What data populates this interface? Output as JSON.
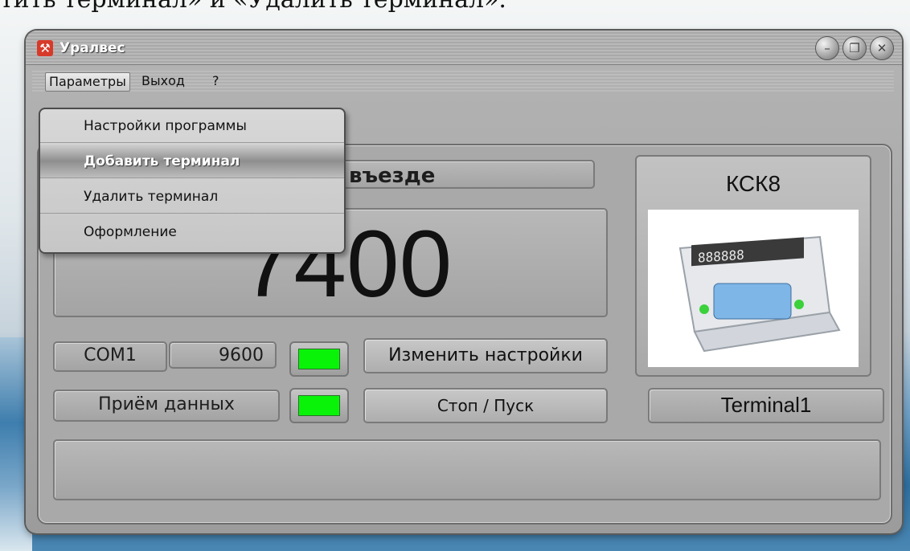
{
  "page_caption": "тить терминал» и «Удалить терминал».",
  "window": {
    "title": "Уралвес",
    "app_icon": "hammer-pick-icon",
    "controls": [
      "minimize-icon",
      "restore-icon",
      "close-icon"
    ]
  },
  "menu": {
    "items": [
      {
        "label": "Параметры",
        "active": true
      },
      {
        "label": "Выход"
      },
      {
        "label": "?"
      }
    ],
    "dropdown": [
      "Настройки программы",
      "Добавить терминал",
      "Удалить терминал",
      "Оформление"
    ],
    "highlighted_index": 1
  },
  "main": {
    "status_label": "въезде",
    "weight_value": "7400",
    "com_port": "COM1",
    "baud_rate": "9600",
    "change_settings_label": "Изменить настройки",
    "data_receive_label": "Приём данных",
    "stop_start_label": "Стоп / Пуск",
    "led_color": "#09f309",
    "message_area": ""
  },
  "terminal": {
    "model": "КСК8",
    "device_display": "888888",
    "name": "Terminal1"
  }
}
